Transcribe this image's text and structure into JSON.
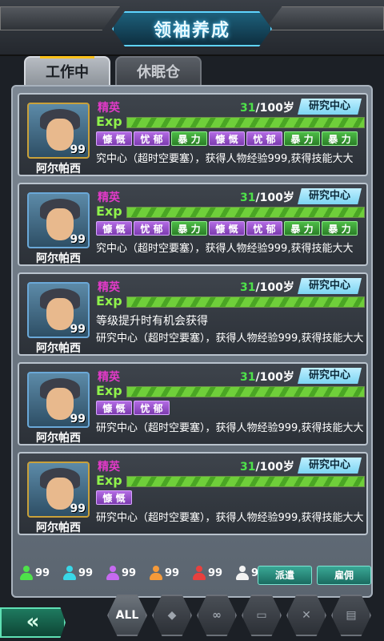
{
  "header": {
    "title": "领袖养成"
  },
  "tabs": {
    "work": "工作中",
    "sleep": "休眠仓"
  },
  "cards": [
    {
      "name": "阿尔帕西",
      "level": "99",
      "rank": "精英",
      "age_current": "31",
      "age_max": "/100岁",
      "dept": "研究中心",
      "exp_label": "Exp",
      "exp_fraction": 1.0,
      "traits": [
        {
          "label": "慷 慨",
          "color": "purple"
        },
        {
          "label": "忧 郁",
          "color": "purple"
        },
        {
          "label": "暴 力",
          "color": "green"
        },
        {
          "label": "慷 慨",
          "color": "purple"
        },
        {
          "label": "忧 郁",
          "color": "purple"
        },
        {
          "label": "暴 力",
          "color": "green"
        },
        {
          "label": "暴 力",
          "color": "green"
        }
      ],
      "description": "究中心（超时空要塞），获得人物经验999,获得技能大大"
    },
    {
      "name": "阿尔帕西",
      "level": "99",
      "rank": "精英",
      "age_current": "31",
      "age_max": "/100岁",
      "dept": "研究中心",
      "exp_label": "Exp",
      "exp_fraction": 1.0,
      "traits": [
        {
          "label": "慷 慨",
          "color": "purple"
        },
        {
          "label": "忧 郁",
          "color": "purple"
        },
        {
          "label": "暴 力",
          "color": "green"
        },
        {
          "label": "慷 慨",
          "color": "purple"
        },
        {
          "label": "忧 郁",
          "color": "purple"
        },
        {
          "label": "暴 力",
          "color": "green"
        },
        {
          "label": "暴 力",
          "color": "green"
        }
      ],
      "description": "究中心（超时空要塞），获得人物经验999,获得技能大大"
    },
    {
      "name": "阿尔帕西",
      "level": "99",
      "rank": "精英",
      "age_current": "31",
      "age_max": "/100岁",
      "dept": "研究中心",
      "exp_label": "Exp",
      "exp_fraction": 1.0,
      "traits": [],
      "notice": "等级提升时有机会获得",
      "description": "研究中心（超时空要塞），获得人物经验999,获得技能大大"
    },
    {
      "name": "阿尔帕西",
      "level": "99",
      "rank": "精英",
      "age_current": "31",
      "age_max": "/100岁",
      "dept": "研究中心",
      "exp_label": "Exp",
      "exp_fraction": 1.0,
      "traits": [
        {
          "label": "慷 慨",
          "color": "purple"
        },
        {
          "label": "忧 郁",
          "color": "purple"
        }
      ],
      "description": "研究中心（超时空要塞），获得人物经验999,获得技能大大"
    },
    {
      "name": "阿尔帕西",
      "level": "99",
      "rank": "精英",
      "age_current": "31",
      "age_max": "/100岁",
      "dept": "研究中心",
      "exp_label": "Exp",
      "exp_fraction": 1.0,
      "traits": [
        {
          "label": "慷 慨",
          "color": "purple"
        }
      ],
      "description": "研究中心（超时空要塞），获得人物经验999,获得技能大大"
    }
  ],
  "counters": [
    {
      "icon": "person-green-icon",
      "color": "#4ee24a",
      "value": "99"
    },
    {
      "icon": "person-cyan-icon",
      "color": "#39d7e8",
      "value": "99"
    },
    {
      "icon": "person-purple-icon",
      "color": "#c66af0",
      "value": "99"
    },
    {
      "icon": "person-orange-icon",
      "color": "#f59a3a",
      "value": "99"
    },
    {
      "icon": "person-red-icon",
      "color": "#e8403e",
      "value": "99"
    },
    {
      "icon": "person-white-icon",
      "color": "#f2f2f2",
      "value": "99"
    }
  ],
  "actions": {
    "dispatch": "派遣",
    "hire": "雇佣"
  },
  "nav": {
    "back": "«",
    "filters": [
      {
        "label": "ALL",
        "icon": "all-icon",
        "active": true
      },
      {
        "label": "◆",
        "icon": "hex-icon",
        "active": false
      },
      {
        "label": "∞",
        "icon": "link-icon",
        "active": false
      },
      {
        "label": "▭",
        "icon": "card-icon",
        "active": false
      },
      {
        "label": "✕",
        "icon": "tools-icon",
        "active": false
      },
      {
        "label": "▤",
        "icon": "book-icon",
        "active": false
      }
    ]
  }
}
